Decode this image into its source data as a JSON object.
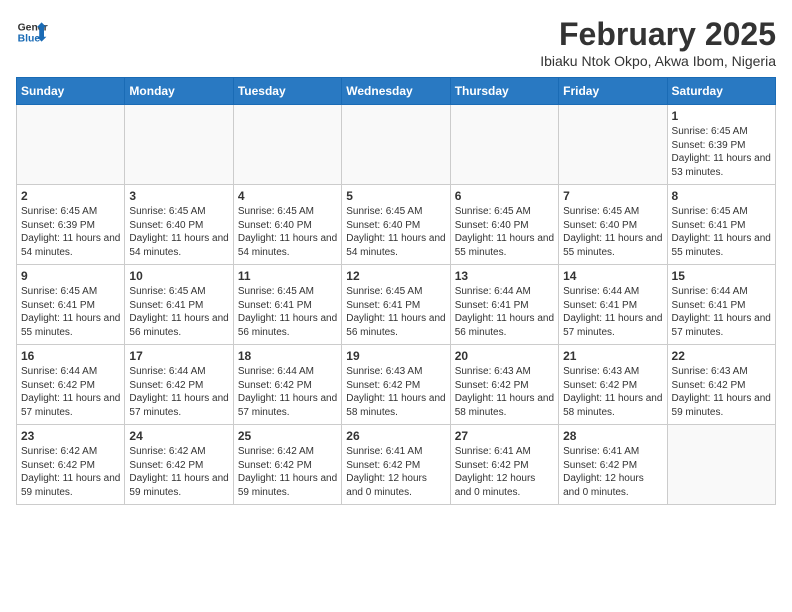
{
  "header": {
    "logo_line1": "General",
    "logo_line2": "Blue",
    "month_title": "February 2025",
    "location": "Ibiaku Ntok Okpo, Akwa Ibom, Nigeria"
  },
  "weekdays": [
    "Sunday",
    "Monday",
    "Tuesday",
    "Wednesday",
    "Thursday",
    "Friday",
    "Saturday"
  ],
  "weeks": [
    [
      {
        "day": "",
        "text": ""
      },
      {
        "day": "",
        "text": ""
      },
      {
        "day": "",
        "text": ""
      },
      {
        "day": "",
        "text": ""
      },
      {
        "day": "",
        "text": ""
      },
      {
        "day": "",
        "text": ""
      },
      {
        "day": "1",
        "text": "Sunrise: 6:45 AM\nSunset: 6:39 PM\nDaylight: 11 hours and 53 minutes."
      }
    ],
    [
      {
        "day": "2",
        "text": "Sunrise: 6:45 AM\nSunset: 6:39 PM\nDaylight: 11 hours and 54 minutes."
      },
      {
        "day": "3",
        "text": "Sunrise: 6:45 AM\nSunset: 6:40 PM\nDaylight: 11 hours and 54 minutes."
      },
      {
        "day": "4",
        "text": "Sunrise: 6:45 AM\nSunset: 6:40 PM\nDaylight: 11 hours and 54 minutes."
      },
      {
        "day": "5",
        "text": "Sunrise: 6:45 AM\nSunset: 6:40 PM\nDaylight: 11 hours and 54 minutes."
      },
      {
        "day": "6",
        "text": "Sunrise: 6:45 AM\nSunset: 6:40 PM\nDaylight: 11 hours and 55 minutes."
      },
      {
        "day": "7",
        "text": "Sunrise: 6:45 AM\nSunset: 6:40 PM\nDaylight: 11 hours and 55 minutes."
      },
      {
        "day": "8",
        "text": "Sunrise: 6:45 AM\nSunset: 6:41 PM\nDaylight: 11 hours and 55 minutes."
      }
    ],
    [
      {
        "day": "9",
        "text": "Sunrise: 6:45 AM\nSunset: 6:41 PM\nDaylight: 11 hours and 55 minutes."
      },
      {
        "day": "10",
        "text": "Sunrise: 6:45 AM\nSunset: 6:41 PM\nDaylight: 11 hours and 56 minutes."
      },
      {
        "day": "11",
        "text": "Sunrise: 6:45 AM\nSunset: 6:41 PM\nDaylight: 11 hours and 56 minutes."
      },
      {
        "day": "12",
        "text": "Sunrise: 6:45 AM\nSunset: 6:41 PM\nDaylight: 11 hours and 56 minutes."
      },
      {
        "day": "13",
        "text": "Sunrise: 6:44 AM\nSunset: 6:41 PM\nDaylight: 11 hours and 56 minutes."
      },
      {
        "day": "14",
        "text": "Sunrise: 6:44 AM\nSunset: 6:41 PM\nDaylight: 11 hours and 57 minutes."
      },
      {
        "day": "15",
        "text": "Sunrise: 6:44 AM\nSunset: 6:41 PM\nDaylight: 11 hours and 57 minutes."
      }
    ],
    [
      {
        "day": "16",
        "text": "Sunrise: 6:44 AM\nSunset: 6:42 PM\nDaylight: 11 hours and 57 minutes."
      },
      {
        "day": "17",
        "text": "Sunrise: 6:44 AM\nSunset: 6:42 PM\nDaylight: 11 hours and 57 minutes."
      },
      {
        "day": "18",
        "text": "Sunrise: 6:44 AM\nSunset: 6:42 PM\nDaylight: 11 hours and 57 minutes."
      },
      {
        "day": "19",
        "text": "Sunrise: 6:43 AM\nSunset: 6:42 PM\nDaylight: 11 hours and 58 minutes."
      },
      {
        "day": "20",
        "text": "Sunrise: 6:43 AM\nSunset: 6:42 PM\nDaylight: 11 hours and 58 minutes."
      },
      {
        "day": "21",
        "text": "Sunrise: 6:43 AM\nSunset: 6:42 PM\nDaylight: 11 hours and 58 minutes."
      },
      {
        "day": "22",
        "text": "Sunrise: 6:43 AM\nSunset: 6:42 PM\nDaylight: 11 hours and 59 minutes."
      }
    ],
    [
      {
        "day": "23",
        "text": "Sunrise: 6:42 AM\nSunset: 6:42 PM\nDaylight: 11 hours and 59 minutes."
      },
      {
        "day": "24",
        "text": "Sunrise: 6:42 AM\nSunset: 6:42 PM\nDaylight: 11 hours and 59 minutes."
      },
      {
        "day": "25",
        "text": "Sunrise: 6:42 AM\nSunset: 6:42 PM\nDaylight: 11 hours and 59 minutes."
      },
      {
        "day": "26",
        "text": "Sunrise: 6:41 AM\nSunset: 6:42 PM\nDaylight: 12 hours and 0 minutes."
      },
      {
        "day": "27",
        "text": "Sunrise: 6:41 AM\nSunset: 6:42 PM\nDaylight: 12 hours and 0 minutes."
      },
      {
        "day": "28",
        "text": "Sunrise: 6:41 AM\nSunset: 6:42 PM\nDaylight: 12 hours and 0 minutes."
      },
      {
        "day": "",
        "text": ""
      }
    ]
  ]
}
